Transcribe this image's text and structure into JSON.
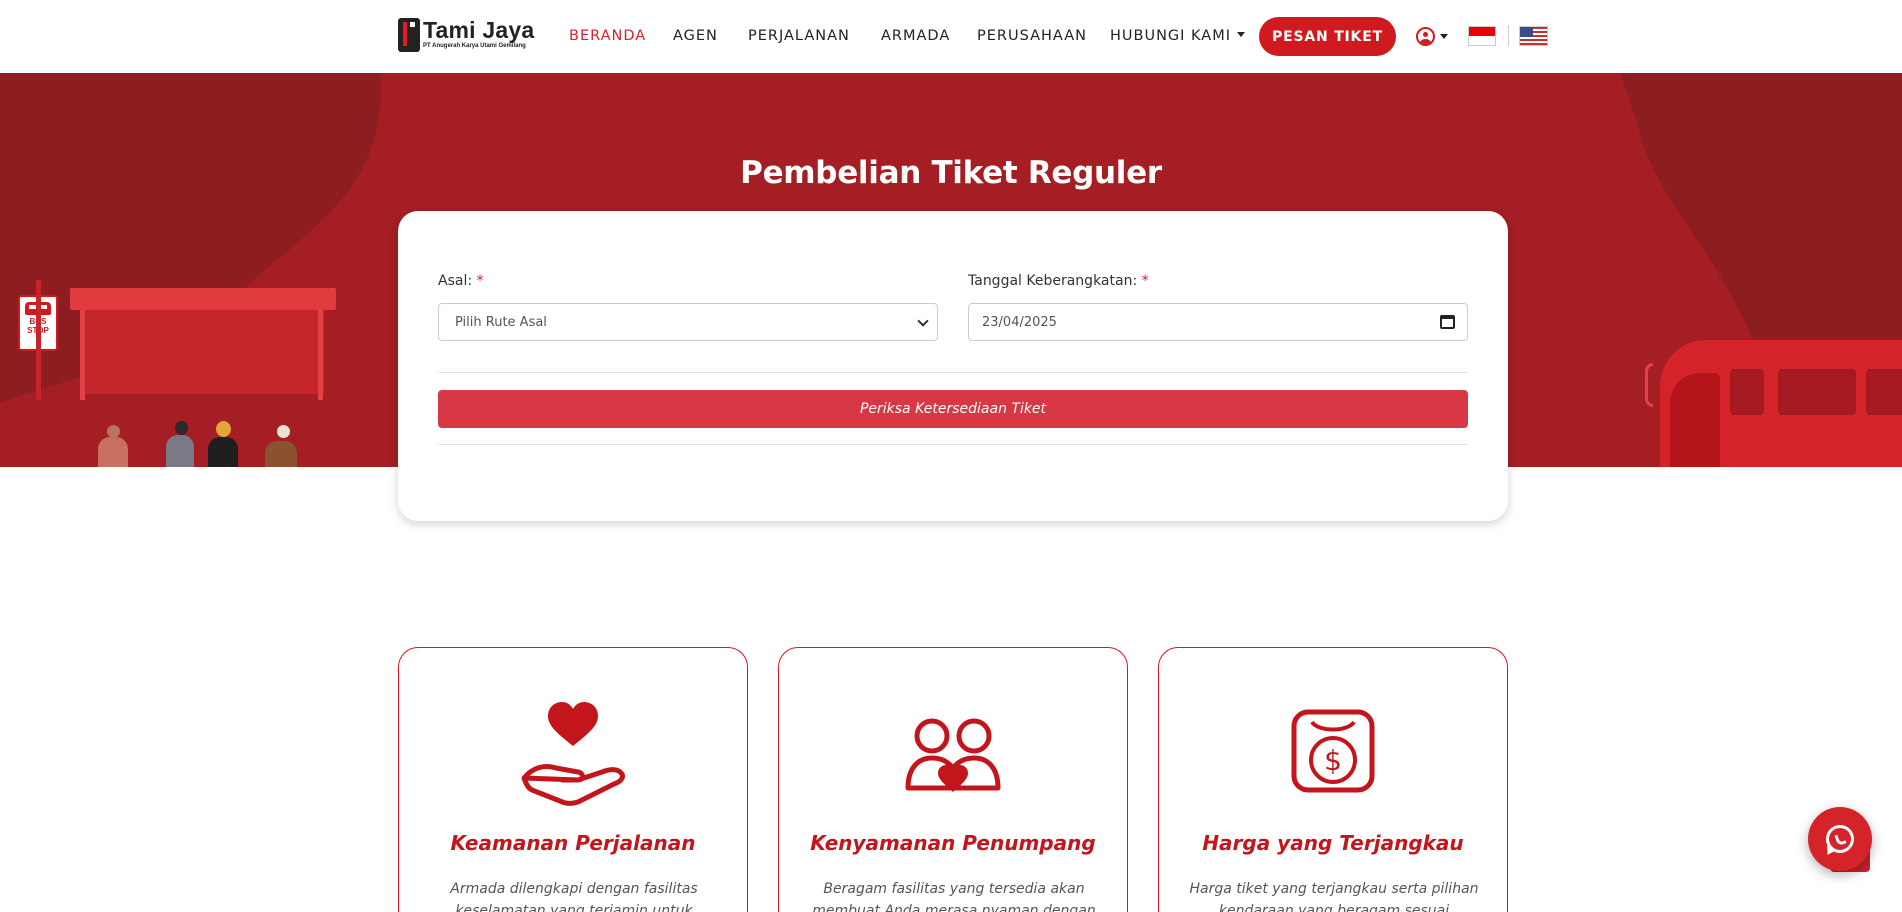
{
  "brand": {
    "name": "Tami Jaya",
    "subtitle": "PT Anugerah Karya Utami Gemilang"
  },
  "nav": {
    "items": [
      {
        "label": "BERANDA",
        "active": true
      },
      {
        "label": "AGEN",
        "active": false
      },
      {
        "label": "PERJALANAN",
        "active": false
      },
      {
        "label": "ARMADA",
        "active": false
      },
      {
        "label": "PERUSAHAAN",
        "active": false
      },
      {
        "label": "HUBUNGI KAMI",
        "active": false,
        "has_dropdown": true
      }
    ],
    "cta_label": "PESAN TIKET"
  },
  "hero": {
    "title": "Pembelian Tiket Reguler",
    "bus_stop_sign": "BUS STOP"
  },
  "form": {
    "origin_label": "Asal:",
    "origin_required": "*",
    "origin_value": "Pilih Rute Asal",
    "date_label": "Tanggal Keberangkatan:",
    "date_required": "*",
    "date_value": "23/04/2025",
    "submit_label": "Periksa Ketersediaan Tiket"
  },
  "features": [
    {
      "icon": "heart-hand-icon",
      "title": "Keamanan Perjalanan",
      "desc": "Armada dilengkapi dengan fasilitas keselamatan yang terjamin untuk"
    },
    {
      "icon": "people-heart-icon",
      "title": "Kenyamanan Penumpang",
      "desc": "Beragam fasilitas yang tersedia akan membuat Anda merasa nyaman dengan"
    },
    {
      "icon": "dollar-bag-icon",
      "title": "Harga yang Terjangkau",
      "desc": "Harga tiket yang terjangkau serta pilihan kendaraan yang beragam sesuai kebutuhan"
    }
  ],
  "colors": {
    "brand_red": "#d11a1f",
    "hero_red": "#a51e23",
    "button_red": "#d83745"
  }
}
